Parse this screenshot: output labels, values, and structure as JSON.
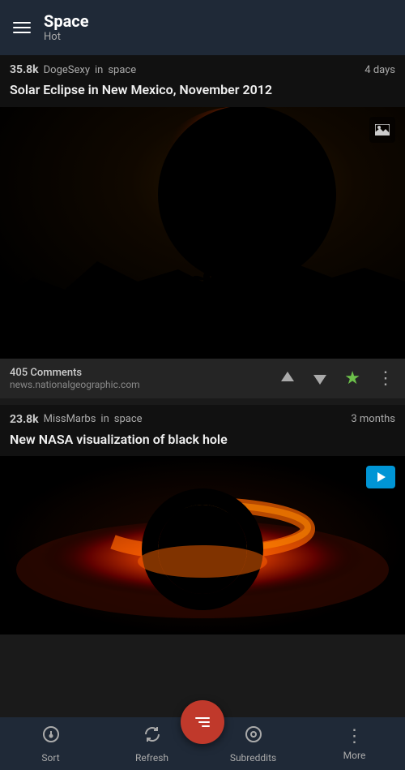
{
  "header": {
    "title": "Space",
    "subtitle": "Hot",
    "menu_label": "Menu"
  },
  "posts": [
    {
      "id": "post1",
      "score": "35.8k",
      "author": "DogeSexy",
      "subreddit": "space",
      "time": "4 days",
      "title": "Solar Eclipse in New Mexico, November 2012",
      "comments": "405 Comments",
      "domain": "news.nationalgeographic.com",
      "type": "image"
    },
    {
      "id": "post2",
      "score": "23.8k",
      "author": "MissMarbs",
      "subreddit": "space",
      "time": "3 months",
      "title": "New NASA visualization of black hole",
      "comments": "",
      "domain": "",
      "type": "video"
    }
  ],
  "bottom_nav": {
    "sort": "Sort",
    "refresh": "Refresh",
    "subreddits": "Subreddits",
    "more": "More"
  },
  "actions": {
    "up": "↑",
    "down": "↓",
    "star": "★",
    "more": "⋮"
  }
}
